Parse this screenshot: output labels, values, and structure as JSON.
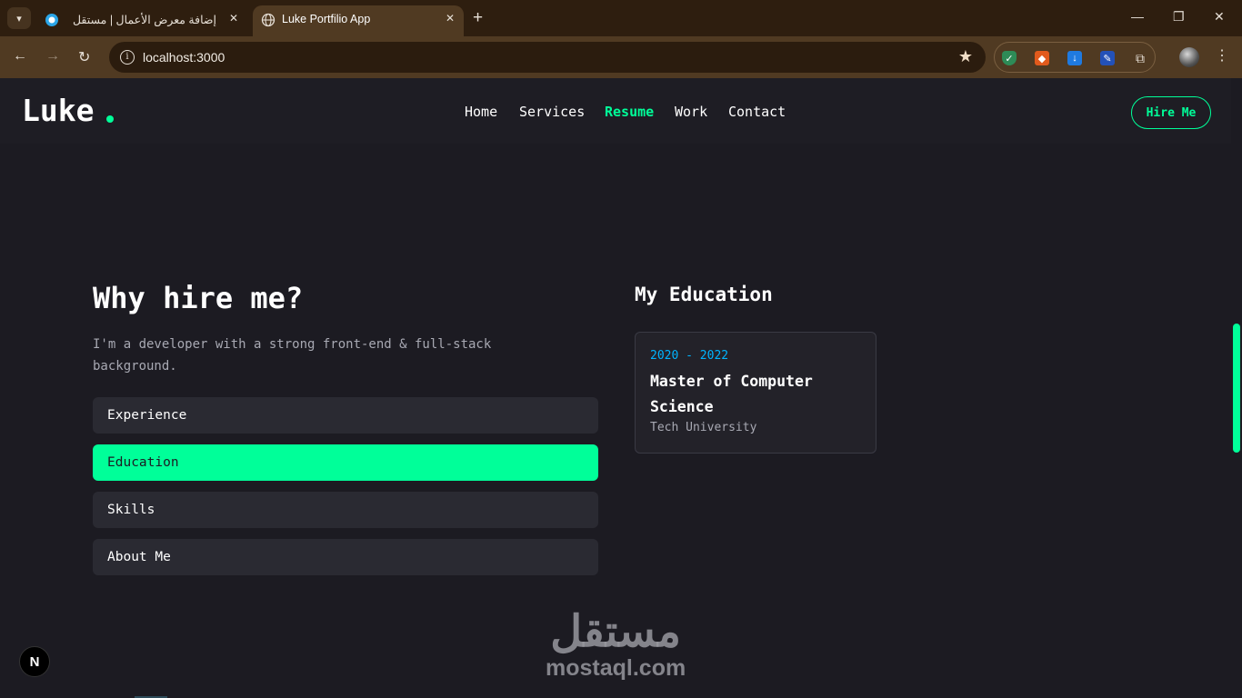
{
  "browser": {
    "tabs": [
      {
        "title": "إضافة معرض الأعمال | مستقل",
        "close": "✕"
      },
      {
        "title": "Luke Portfilio App",
        "close": "✕"
      }
    ],
    "new_tab": "+",
    "window_controls": {
      "minimize": "—",
      "restore": "❐",
      "close": "✕"
    },
    "url": "localhost:3000",
    "nav": {
      "back": "←",
      "forward": "→",
      "reload": "↻"
    },
    "star": "★",
    "menu": "⋮"
  },
  "site": {
    "logo": "Luke",
    "nav": [
      "Home",
      "Services",
      "Resume",
      "Work",
      "Contact"
    ],
    "active_nav": "Resume",
    "hire_button": "Hire Me"
  },
  "resume": {
    "title": "Why hire me?",
    "description": "I'm a developer with a strong front-end & full-stack background.",
    "tabs": [
      "Experience",
      "Education",
      "Skills",
      "About Me"
    ],
    "active_tab": "Education"
  },
  "education": {
    "title": "My Education",
    "items": [
      {
        "years": "2020 - 2022",
        "degree": "Master of Computer Science",
        "school": "Tech University"
      }
    ]
  },
  "badge": "N",
  "watermark": {
    "arabic": "مستقل",
    "latin": "mostaql.com"
  },
  "colors": {
    "accent": "#00ff99",
    "background": "#1c1b22",
    "chrome": "#503a22",
    "years": "#00b4ff"
  }
}
